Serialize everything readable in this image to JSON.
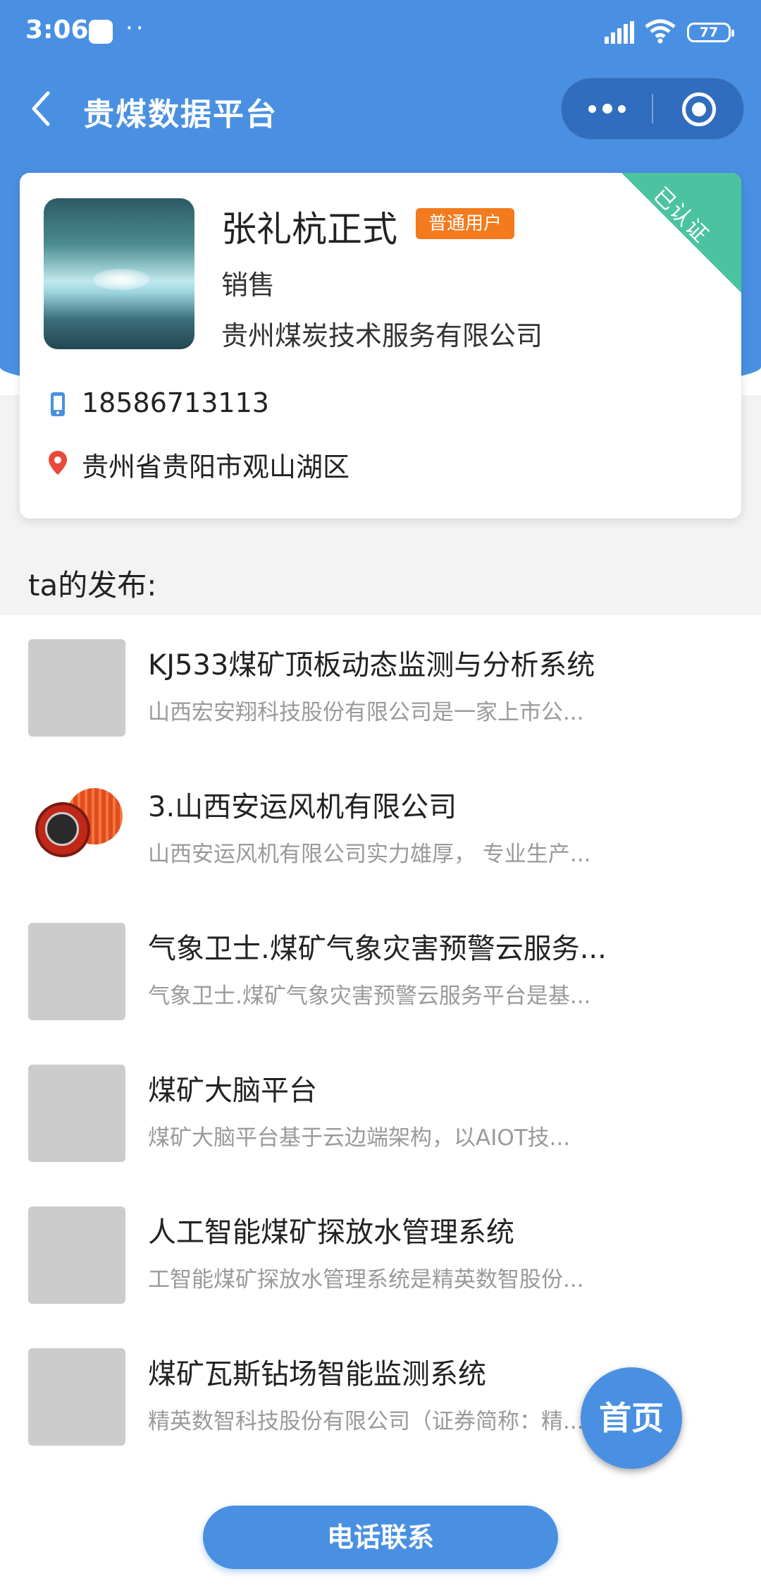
{
  "status_bar": {
    "time": "3:06",
    "dots": "··",
    "battery": "77"
  },
  "nav": {
    "title": "贵煤数据平台"
  },
  "profile": {
    "name": "张礼杭正式",
    "badge": "普通用户",
    "role": "销售",
    "company": "贵州煤炭技术服务有限公司",
    "verified_label": "已认证",
    "phone": "18586713113",
    "location": "贵州省贵阳市观山湖区"
  },
  "section_title": "ta的发布:",
  "posts": [
    {
      "title": "KJ533煤矿顶板动态监测与分析系统",
      "desc": "山西宏安翔科技股份有限公司是一家上市公..."
    },
    {
      "title": "3.山西安运风机有限公司",
      "desc": "山西安运风机有限公司实力雄厚， 专业生产..."
    },
    {
      "title": "气象卫士.煤矿气象灾害预警云服务...",
      "desc": "气象卫士.煤矿气象灾害预警云服务平台是基..."
    },
    {
      "title": "煤矿大脑平台",
      "desc": "煤矿大脑平台基于云边端架构，以AIOT技..."
    },
    {
      "title": "人工智能煤矿探放水管理系统",
      "desc": "工智能煤矿探放水管理系统是精英数智股份..."
    },
    {
      "title": "煤矿瓦斯钻场智能监测系统",
      "desc": "精英数智科技股份有限公司（证券简称：精..."
    }
  ],
  "home_button": "首页",
  "call_button": "电话联系",
  "colors": {
    "primary": "#4a90e2",
    "badge": "#f37b1d",
    "verified": "#4cc3a0"
  }
}
